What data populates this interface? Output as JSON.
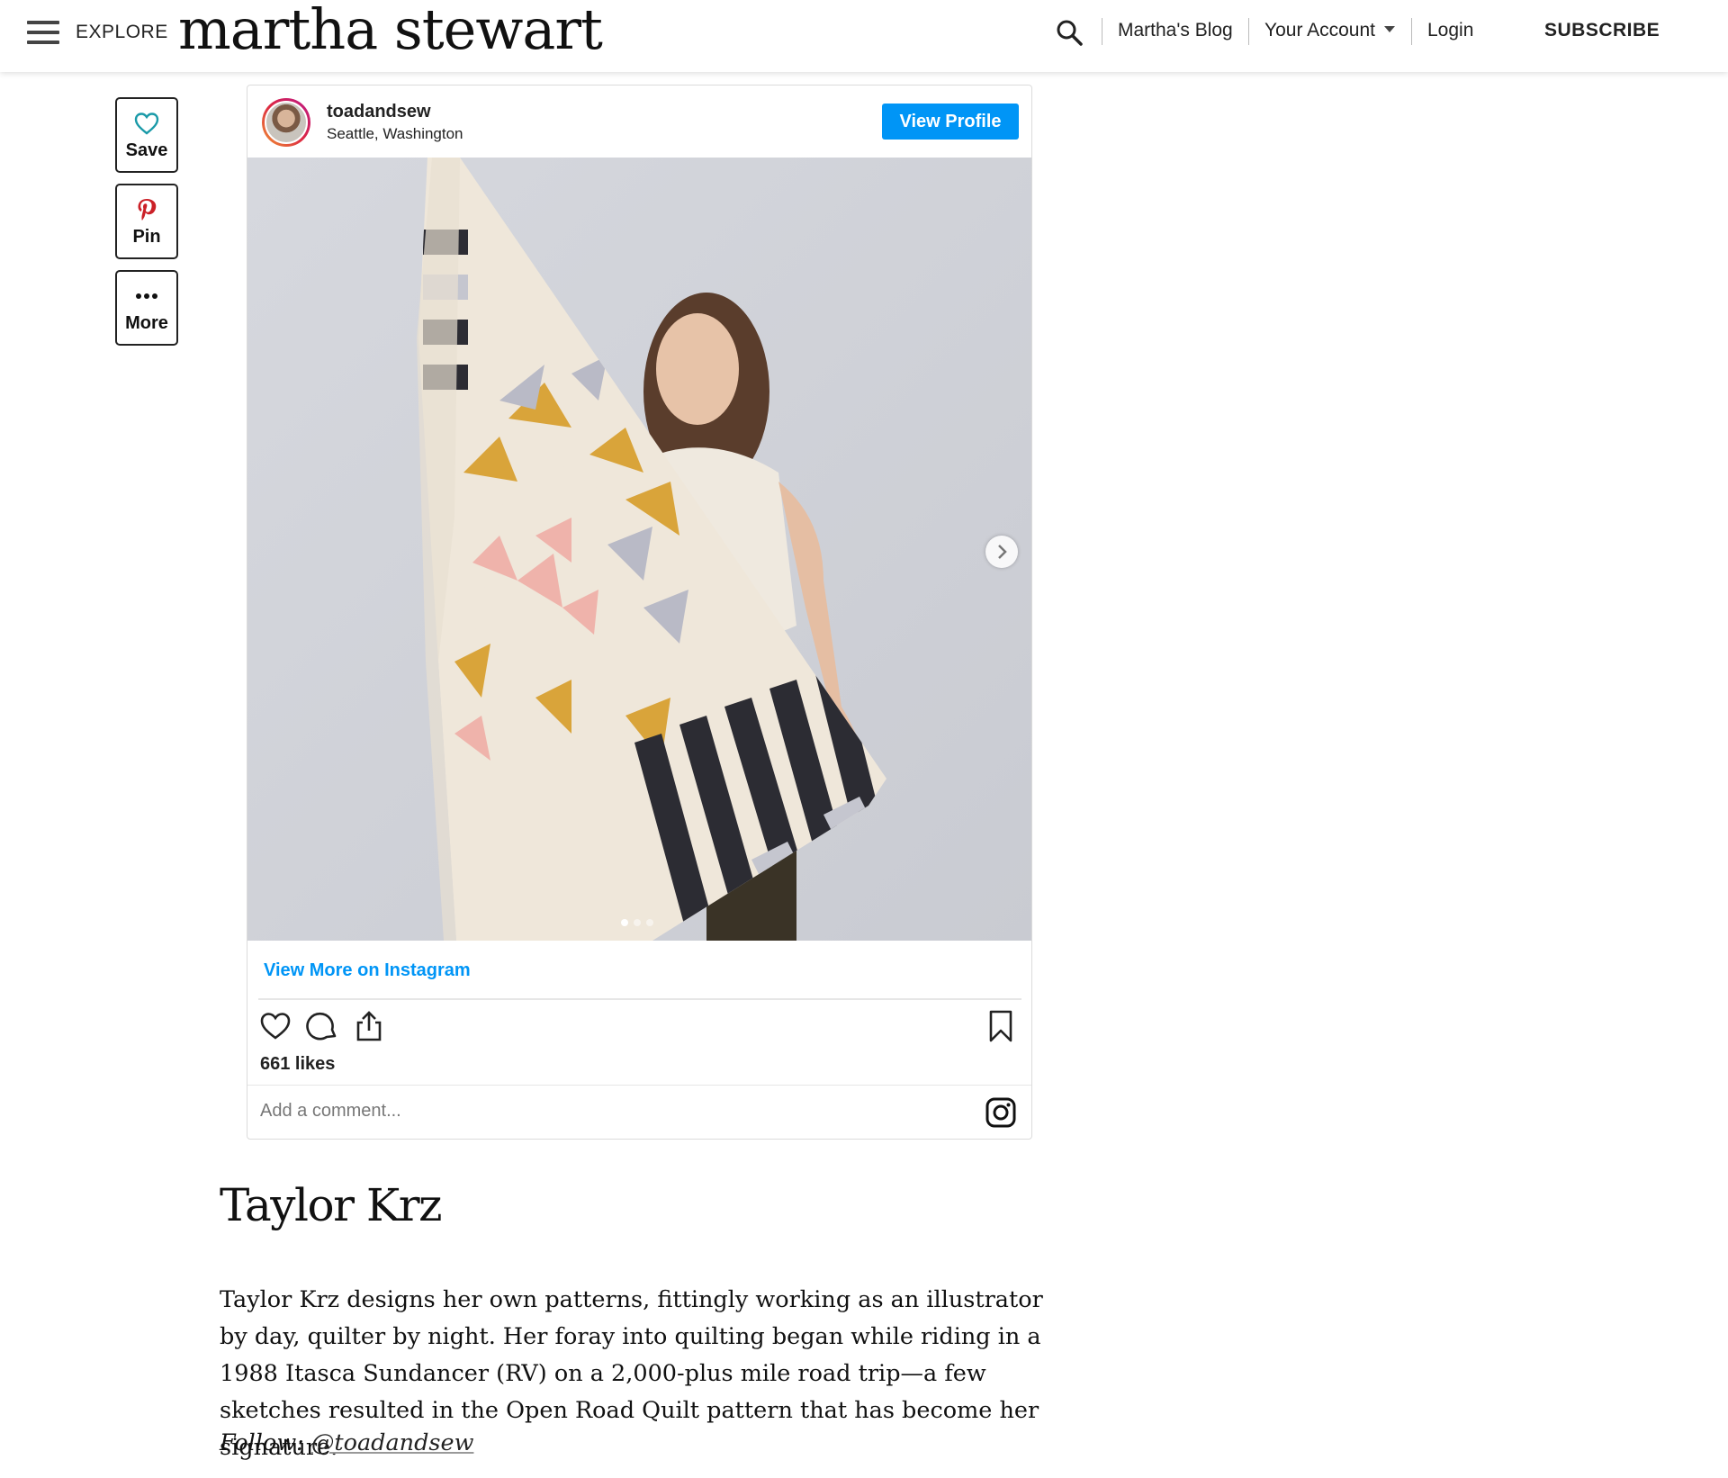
{
  "header": {
    "explore_label": "EXPLORE",
    "logo_text": "martha stewart",
    "nav": {
      "blog": "Martha's Blog",
      "account": "Your Account",
      "login": "Login",
      "subscribe": "SUBSCRIBE"
    }
  },
  "social": {
    "save": "Save",
    "pin": "Pin",
    "more": "More"
  },
  "instagram": {
    "username": "toadandsew",
    "location": "Seattle, Washington",
    "view_profile": "View Profile",
    "view_more": "View More on Instagram",
    "likes": "661 likes",
    "comment_placeholder": "Add a comment..."
  },
  "article": {
    "heading": "Taylor Krz",
    "body": "Taylor Krz designs her own patterns, fittingly working as an illustrator by day, quilter by night. Her foray into quilting began while riding in a 1988 Itasca Sundancer (RV) on a 2,000-plus mile road trip—a few sketches resulted in the Open Road Quilt pattern that has become her signature.",
    "follow_label": "Follow:",
    "follow_handle": "@toadandsew"
  },
  "colors": {
    "instagram_blue": "#0095f6",
    "save_heart": "#1a9aa8",
    "pinterest_red": "#cb2027"
  }
}
